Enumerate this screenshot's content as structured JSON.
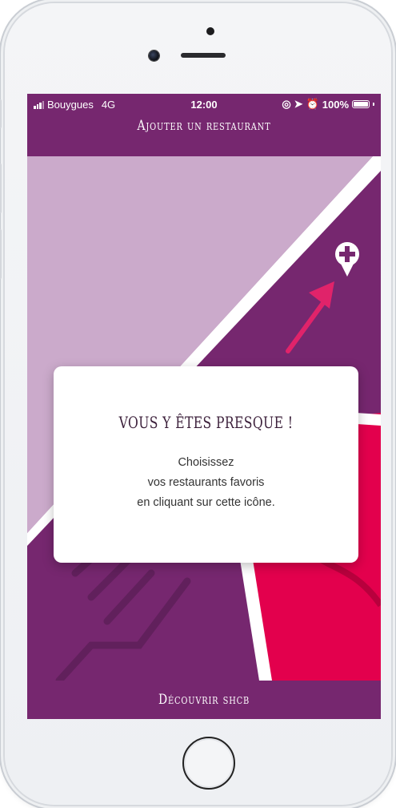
{
  "status_bar": {
    "carrier": "Bouygues",
    "network": "4G",
    "time": "12:00",
    "battery": "100%"
  },
  "header": {
    "title": "Ajouter un restaurant"
  },
  "modal": {
    "title": "VOUS Y ÊTES PRESQUE !",
    "lines": [
      "Choisissez",
      "vos restaurants favoris",
      "en cliquant sur cette icône."
    ]
  },
  "footer": {
    "button_label": "Découvrir shcb"
  },
  "colors": {
    "brand_purple": "#76276f",
    "light_purple": "#cbaacb",
    "accent_pink": "#e3004d",
    "arrow_pink": "#e0236a"
  },
  "icons": {
    "add_location": "map-pin-plus-icon",
    "arrow": "arrow-up-right-icon"
  }
}
